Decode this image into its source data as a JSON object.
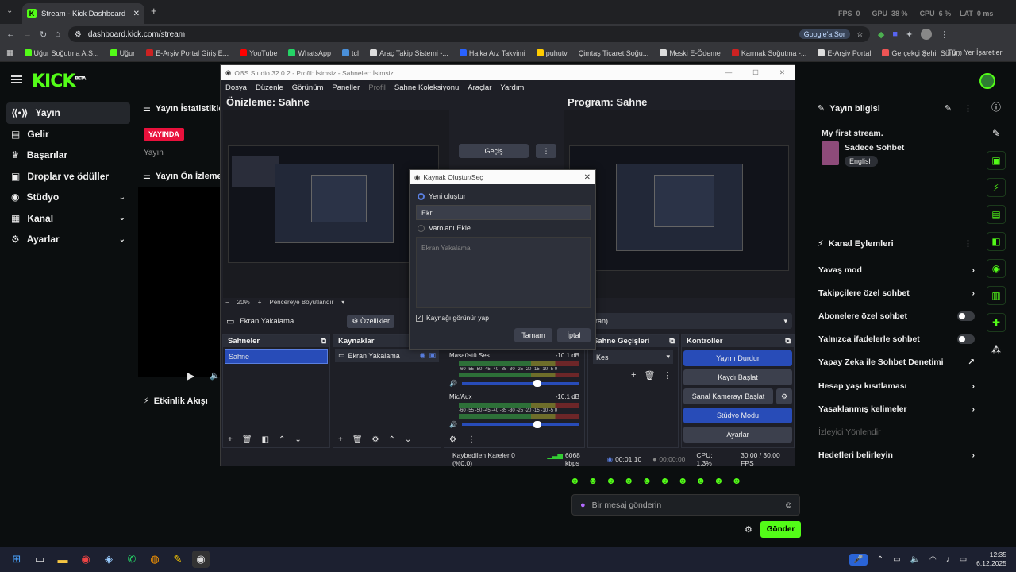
{
  "browser": {
    "tab_title": "Stream - Kick Dashboard",
    "url": "dashboard.kick.com/stream",
    "google_btn": "Google'a Sor",
    "perf": {
      "fps_label": "FPS",
      "fps": "0",
      "gpu_label": "GPU",
      "gpu": "38 %",
      "cpu_label": "CPU",
      "cpu": "6 %",
      "lat_label": "LAT",
      "lat": "0 ms"
    },
    "bookmarks": [
      "Uğur Soğutma A.S...",
      "Uğur",
      "E-Arşiv Portal Giriş E...",
      "YouTube",
      "WhatsApp",
      "tcl",
      "Araç Takip Sistemi -...",
      "Halka Arz Takvimi",
      "puhutv",
      "Çimtaş Ticaret Soğu...",
      "Meski E-Ödeme",
      "Karmak Soğutma -...",
      "E-Arşiv Portal",
      "Gerçekçi Şehir Sürü..."
    ],
    "all_bookmarks": "Tüm Yer İşaretleri"
  },
  "kick": {
    "logo": "KICK",
    "beta": "BETA",
    "sidebar": [
      {
        "label": "Yayın",
        "icon": "broadcast-icon"
      },
      {
        "label": "Gelir",
        "icon": "revenue-icon"
      },
      {
        "label": "Başarılar",
        "icon": "trophy-icon"
      },
      {
        "label": "Droplar ve ödüller",
        "icon": "gift-icon"
      },
      {
        "label": "Stüdyo",
        "icon": "studio-icon"
      },
      {
        "label": "Kanal",
        "icon": "channel-icon"
      },
      {
        "label": "Ayarlar",
        "icon": "settings-icon"
      }
    ],
    "stats_title": "Yayın İstatistikleri",
    "live_badge": "YAYINDA",
    "stats_sub": "Yayın",
    "preview_title": "Yayın Ön İzlemesi",
    "activity_title": "Etkinlik Akışı",
    "stream_info": {
      "title": "Yayın bilgisi",
      "stream_name": "My first stream.",
      "category": "Sadece Sohbet",
      "language": "English"
    },
    "channel_actions": {
      "title": "Kanal Eylemleri",
      "items": [
        {
          "label": "Yavaş mod",
          "type": "arrow"
        },
        {
          "label": "Takipçilere özel sohbet",
          "type": "arrow"
        },
        {
          "label": "Abonelere özel sohbet",
          "type": "toggle"
        },
        {
          "label": "Yalnızca ifadelerle sohbet",
          "type": "toggle"
        },
        {
          "label": "Yapay Zeka ile Sohbet Denetimi",
          "type": "ext"
        },
        {
          "label": "Hesap yaşı kısıtlaması",
          "type": "arrow"
        },
        {
          "label": "Yasaklanmış kelimeler",
          "type": "arrow"
        },
        {
          "label": "İzleyici Yönlendir",
          "type": "disabled"
        },
        {
          "label": "Hedefleri belirleyin",
          "type": "arrow"
        }
      ]
    },
    "chat": {
      "placeholder": "Bir mesaj gönderin",
      "send": "Gönder"
    }
  },
  "obs": {
    "title": "OBS Studio 32.0.2 - Profil: İsimsiz - Sahneler: İsimsiz",
    "menu": [
      "Dosya",
      "Düzenle",
      "Görünüm",
      "Paneller",
      "Profil",
      "Sahne Koleksiyonu",
      "Araçlar",
      "Yardım"
    ],
    "preview": "Önizleme: Sahne",
    "program": "Program: Sahne",
    "transition": "Geçiş",
    "zoom": "20%",
    "zoom_mode": "Pencereye Boyutlandır",
    "source_name": "Ekran Yakalama",
    "properties": "Özellikler",
    "program_suffix": "ran)",
    "docks": {
      "scenes": "Sahneler",
      "sources": "Kaynaklar",
      "transitions": "Sahne Geçişleri",
      "controls": "Kontroller"
    },
    "scene_item": "Sahne",
    "source_item": "Ekran Yakalama",
    "transition_value": "Kes",
    "audio": [
      {
        "name": "Masaüstü Ses",
        "db": "-10.1 dB"
      },
      {
        "name": "Mic/Aux",
        "db": "-10.1 dB"
      }
    ],
    "meter_ticks": "-60 -55 -50 -45 -40 -35 -30 -25 -20 -15 -10 -5 0",
    "controls": [
      "Yayını Durdur",
      "Kaydı Başlat",
      "Sanal Kamerayı Başlat",
      "Stüdyo Modu",
      "Ayarlar"
    ],
    "status": {
      "dropped": "Kaybedilen Kareler 0 (%0.0)",
      "kbps": "6068 kbps",
      "live_time": "00:01:10",
      "rec_time": "00:00:00",
      "cpu": "CPU: 1.3%",
      "fps": "30.00 / 30.00 FPS"
    }
  },
  "dialog": {
    "title": "Kaynak Oluştur/Seç",
    "create_new": "Yeni oluştur",
    "name_value": "Ekr",
    "add_existing": "Varolanı Ekle",
    "existing_item": "Ekran Yakalama",
    "visible": "Kaynağı görünür yap",
    "ok": "Tamam",
    "cancel": "İptal"
  },
  "taskbar": {
    "time": "12:35",
    "date": "6.12.2025"
  }
}
